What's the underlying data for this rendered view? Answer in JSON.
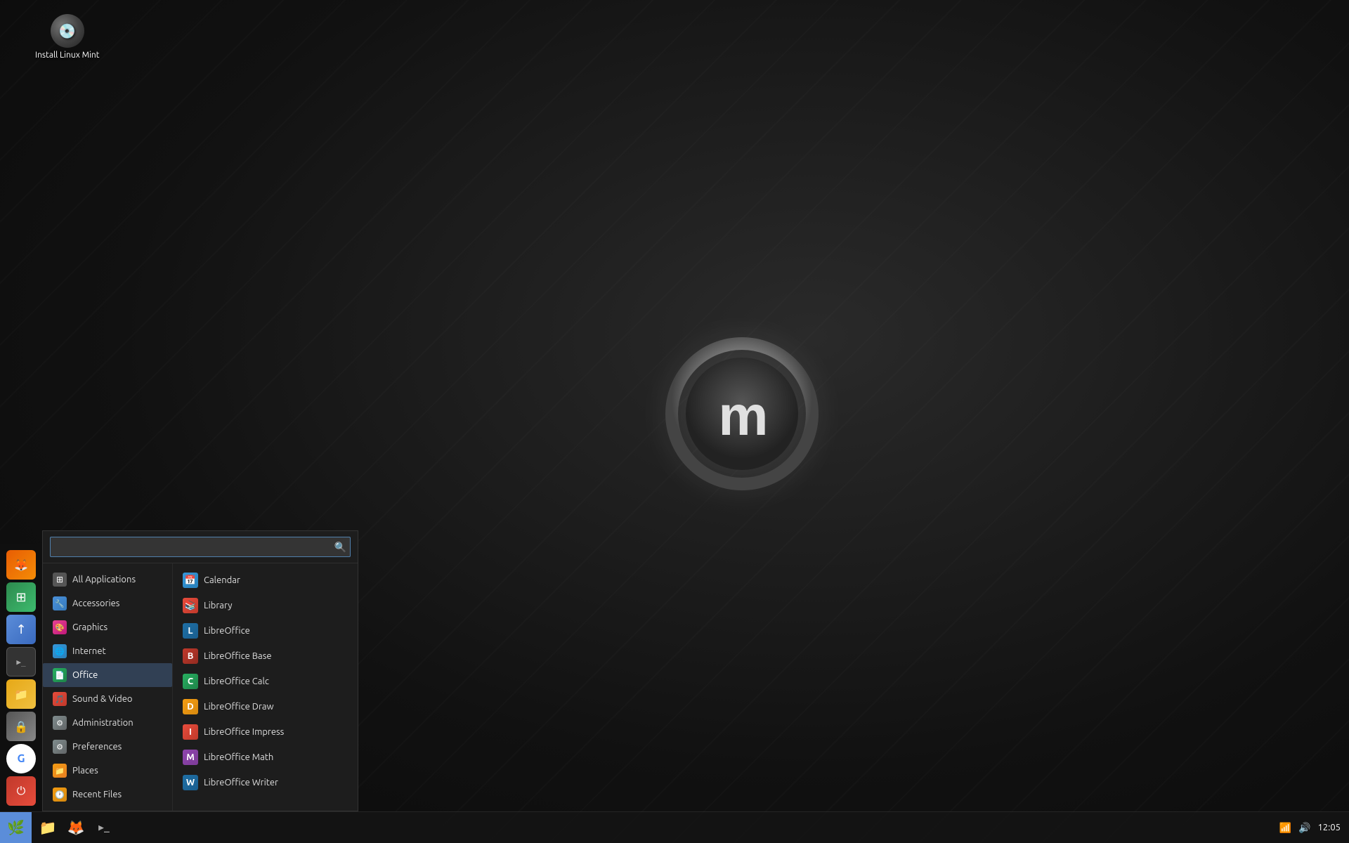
{
  "desktop": {
    "icon": {
      "label": "Install Linux Mint",
      "symbol": "💿"
    }
  },
  "menu": {
    "search_placeholder": "",
    "categories": [
      {
        "id": "all",
        "label": "All Applications",
        "icon": "⊞",
        "icon_class": "ic-all",
        "active": false
      },
      {
        "id": "accessories",
        "label": "Accessories",
        "icon": "🔧",
        "icon_class": "ic-accessories",
        "active": false
      },
      {
        "id": "graphics",
        "label": "Graphics",
        "icon": "🎨",
        "icon_class": "ic-graphics",
        "active": false
      },
      {
        "id": "internet",
        "label": "Internet",
        "icon": "🌐",
        "icon_class": "ic-internet",
        "active": false
      },
      {
        "id": "office",
        "label": "Office",
        "icon": "📄",
        "icon_class": "ic-office",
        "active": true
      },
      {
        "id": "soundvideo",
        "label": "Sound & Video",
        "icon": "🎵",
        "icon_class": "ic-soundvideo",
        "active": false
      },
      {
        "id": "administration",
        "label": "Administration",
        "icon": "⚙",
        "icon_class": "ic-admin",
        "active": false
      },
      {
        "id": "preferences",
        "label": "Preferences",
        "icon": "⚙",
        "icon_class": "ic-prefs",
        "active": false
      },
      {
        "id": "places",
        "label": "Places",
        "icon": "📁",
        "icon_class": "ic-places",
        "active": false
      },
      {
        "id": "recentfiles",
        "label": "Recent Files",
        "icon": "🕐",
        "icon_class": "ic-recent",
        "active": false
      }
    ],
    "apps": [
      {
        "id": "calendar",
        "label": "Calendar",
        "icon": "📅",
        "icon_class": "ic-calendar"
      },
      {
        "id": "library",
        "label": "Library",
        "icon": "📚",
        "icon_class": "ic-library"
      },
      {
        "id": "libreoffice",
        "label": "LibreOffice",
        "icon": "L",
        "icon_class": "ic-lo"
      },
      {
        "id": "libreoffice-base",
        "label": "LibreOffice Base",
        "icon": "B",
        "icon_class": "ic-lo-base"
      },
      {
        "id": "libreoffice-calc",
        "label": "LibreOffice Calc",
        "icon": "C",
        "icon_class": "ic-lo-calc"
      },
      {
        "id": "libreoffice-draw",
        "label": "LibreOffice Draw",
        "icon": "D",
        "icon_class": "ic-lo-draw"
      },
      {
        "id": "libreoffice-impress",
        "label": "LibreOffice Impress",
        "icon": "I",
        "icon_class": "ic-lo-impress"
      },
      {
        "id": "libreoffice-math",
        "label": "LibreOffice Math",
        "icon": "M",
        "icon_class": "ic-lo-math"
      },
      {
        "id": "libreoffice-writer",
        "label": "LibreOffice Writer",
        "icon": "W",
        "icon_class": "ic-lo-writer"
      }
    ]
  },
  "panel_icons": [
    {
      "id": "firefox",
      "icon": "🦊",
      "icon_class": "ic-firefox"
    },
    {
      "id": "mintmenu",
      "icon": "⊞",
      "icon_class": "ic-green"
    },
    {
      "id": "mintupdate",
      "icon": "↑",
      "icon_class": "ic-mint"
    },
    {
      "id": "terminal",
      "icon": ">_",
      "icon_class": "ic-term"
    },
    {
      "id": "files",
      "icon": "📁",
      "icon_class": "ic-folder"
    },
    {
      "id": "lock",
      "icon": "🔒",
      "icon_class": "ic-lock"
    },
    {
      "id": "google",
      "icon": "G",
      "icon_class": "ic-google"
    },
    {
      "id": "power",
      "icon": "⏻",
      "icon_class": "ic-power"
    }
  ],
  "taskbar": {
    "start_icon": "🌿",
    "apps": [
      {
        "id": "files",
        "icon": "📁",
        "icon_class": "ic-folder"
      },
      {
        "id": "firefox",
        "icon": "🦊",
        "icon_class": "ic-firefox"
      },
      {
        "id": "terminal",
        "icon": ">_",
        "icon_class": "ic-term"
      }
    ],
    "time": "12:05",
    "volume_icon": "🔊",
    "network_icon": "📶"
  }
}
